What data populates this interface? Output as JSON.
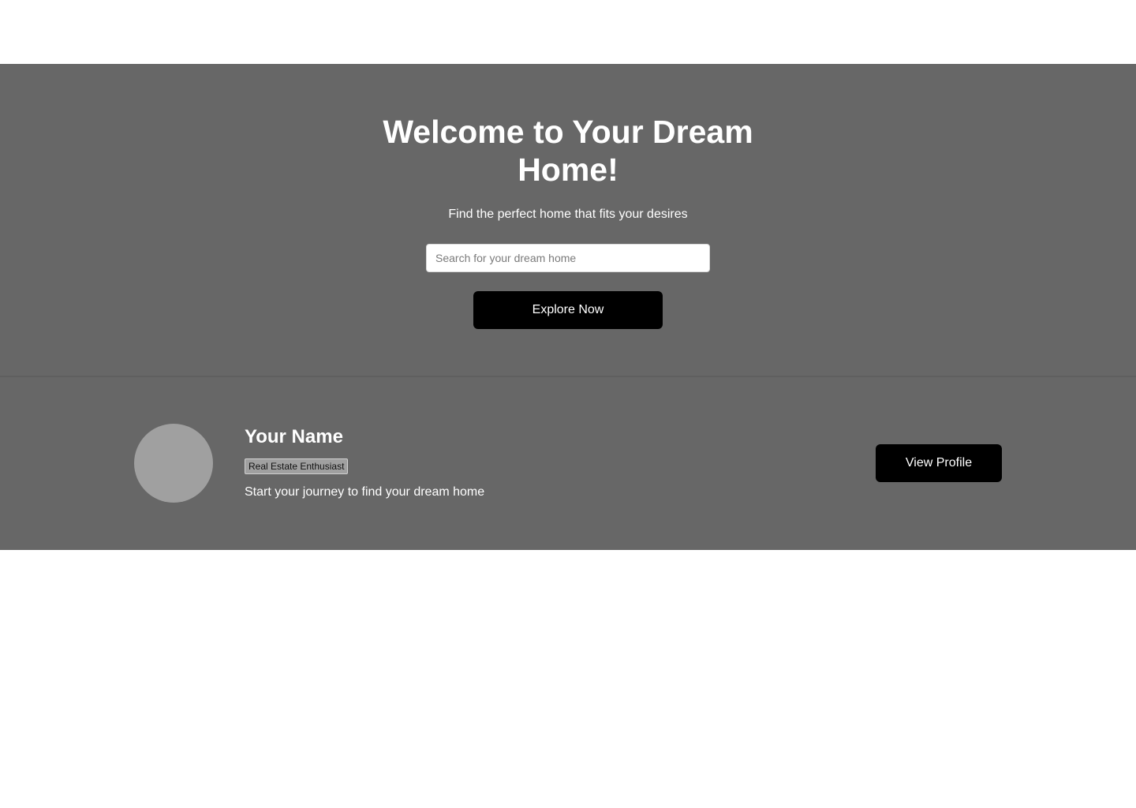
{
  "hero": {
    "title": "Welcome to Your Dream Home!",
    "subtitle": "Find the perfect home that fits your desires",
    "search_placeholder": "Search for your dream home",
    "search_value": "",
    "explore_label": "Explore Now"
  },
  "profile": {
    "avatar_icon": "avatar-placeholder-icon",
    "name": "Your Name",
    "tag": "Real Estate Enthusiast",
    "description": "Start your journey to find your dream home",
    "view_profile_label": "View Profile"
  },
  "colors": {
    "section_background": "#676767",
    "button_background": "#000000",
    "avatar_placeholder": "#a0a0a0",
    "text": "#ffffff"
  }
}
